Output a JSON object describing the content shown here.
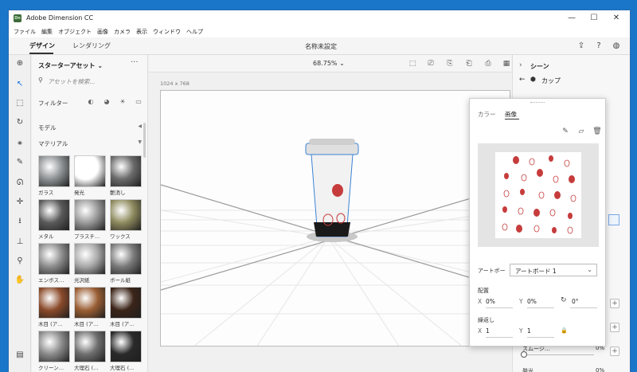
{
  "app": {
    "title": "Adobe Dimension CC",
    "icon_text": "Dn"
  },
  "window_controls": {
    "minimize": "—",
    "maximize": "☐",
    "close": "✕"
  },
  "menu": [
    "ファイル",
    "編集",
    "オブジェクト",
    "画像",
    "カメラ",
    "表示",
    "ウィンドウ",
    "ヘルプ"
  ],
  "header": {
    "tabs": [
      {
        "label": "デザイン",
        "active": true
      },
      {
        "label": "レンダリング",
        "active": false
      }
    ],
    "doc_title": "名称未設定"
  },
  "assets": {
    "title": "スターターアセット",
    "search_placeholder": "アセットを検索...",
    "filter_label": "フィルター",
    "sections": [
      "モデル",
      "マテリアル"
    ],
    "materials": [
      {
        "label": "ガラス",
        "color": "#8e9294"
      },
      {
        "label": "発光",
        "color": "#ffffff"
      },
      {
        "label": "艶消し",
        "color": "#6b6b6b"
      },
      {
        "label": "メタル",
        "color": "#5a5a5a"
      },
      {
        "label": "プラスチ…",
        "color": "#9a9a9a"
      },
      {
        "label": "ワックス",
        "color": "#8e8a5e"
      },
      {
        "label": "エンボス…",
        "color": "#8c8c8c"
      },
      {
        "label": "光沢紙",
        "color": "#a8a8a8"
      },
      {
        "label": "ボール紙",
        "color": "#7a7a7a"
      },
      {
        "label": "木目 (ア…",
        "color": "#8a4a2a"
      },
      {
        "label": "木目 (ア…",
        "color": "#9a5e34"
      },
      {
        "label": "木目 (ア…",
        "color": "#3b2418"
      },
      {
        "label": "クリーン…",
        "color": "#8a8a8a"
      },
      {
        "label": "大理石 (…",
        "color": "#6e6e6e"
      },
      {
        "label": "大理石 (…",
        "color": "#2a2a2a"
      }
    ]
  },
  "viewport": {
    "zoom": "68.75%",
    "canvas_size": "1024 x 768"
  },
  "scene": {
    "title": "シーン",
    "selected": "カップ"
  },
  "popover": {
    "tabs": [
      {
        "label": "カラー",
        "active": false
      },
      {
        "label": "画像",
        "active": true
      }
    ],
    "artboard_label": "アートボー",
    "artboard_value": "アートボード 1",
    "placement_label": "配置",
    "x_label": "X",
    "x_value": "0%",
    "y_label": "Y",
    "y_value": "0%",
    "rotation_value": "0°",
    "repeat_label": "繰返し",
    "repeat_x_label": "X",
    "repeat_x_value": "1",
    "repeat_y_label": "Y",
    "repeat_y_value": "1"
  },
  "scene_panel_peek": {
    "smooth_label": "スムージ…",
    "smooth_value": "0%",
    "glow_label": "発光",
    "glow_value": "0%"
  }
}
